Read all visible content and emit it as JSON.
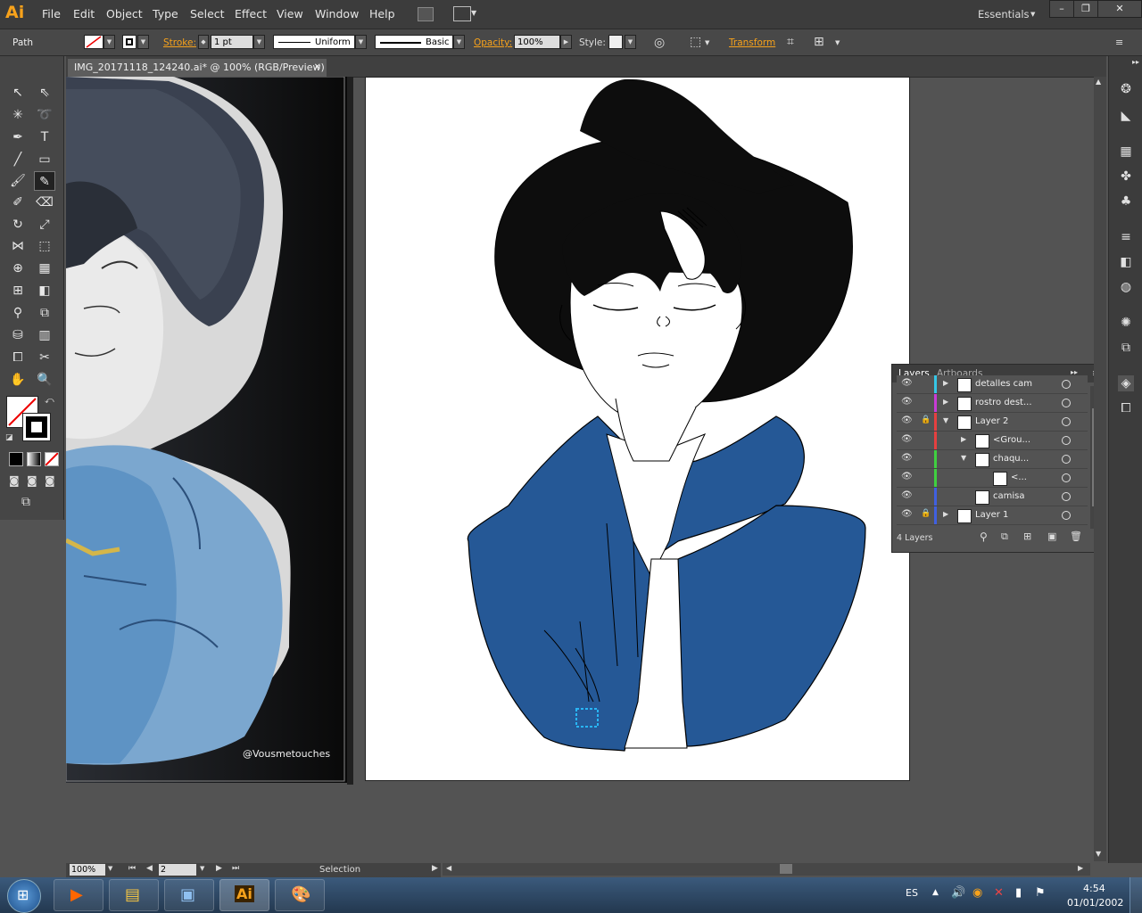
{
  "app": {
    "logo": "Ai",
    "workspace": "Essentials"
  },
  "menu": [
    "File",
    "Edit",
    "Object",
    "Type",
    "Select",
    "Effect",
    "View",
    "Window",
    "Help"
  ],
  "control": {
    "selection_type": "Path",
    "stroke_label": "Stroke:",
    "stroke_weight": "1 pt",
    "profile": "Uniform",
    "brush": "Basic",
    "opacity_label": "Opacity:",
    "opacity": "100%",
    "style_label": "Style:",
    "transform_label": "Transform"
  },
  "document": {
    "tab_title": "IMG_20171118_124240.ai* @ 100% (RGB/Preview)"
  },
  "photo": {
    "watermark": "@Vousmetouches"
  },
  "layers_panel": {
    "tabs": [
      "Layers",
      "Artboards"
    ],
    "rows": [
      {
        "name": "detalles cam",
        "color": "#35c6e6",
        "indent": 0,
        "expand": "right"
      },
      {
        "name": "rostro dest...",
        "color": "#c93bd6",
        "indent": 0,
        "expand": "right"
      },
      {
        "name": "Layer 2",
        "color": "#e64040",
        "indent": 0,
        "expand": "down"
      },
      {
        "name": "<Grou...",
        "color": "#e64040",
        "indent": 1,
        "expand": "right"
      },
      {
        "name": "chaqu...",
        "color": "#40d040",
        "indent": 1,
        "expand": "down"
      },
      {
        "name": "<...",
        "color": "#40d040",
        "indent": 2,
        "expand": ""
      },
      {
        "name": "camisa",
        "color": "#4060e0",
        "indent": 1,
        "expand": ""
      },
      {
        "name": "Layer 1",
        "color": "#4060e0",
        "indent": 0,
        "expand": "right"
      }
    ],
    "count": "4 Layers"
  },
  "status": {
    "zoom": "100%",
    "artboard": "2",
    "tool": "Selection"
  },
  "taskbar": {
    "lang": "ES",
    "time": "4:54",
    "date": "01/01/2002"
  },
  "colors": {
    "jacket": "#255896",
    "accent": "#f7a21b"
  }
}
